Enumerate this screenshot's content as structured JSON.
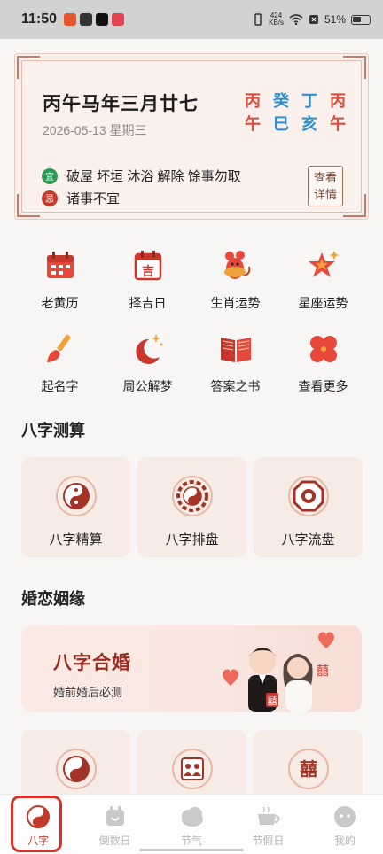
{
  "status_bar": {
    "time": "11:50",
    "net_speed_value": "424",
    "net_speed_unit": "KB/s",
    "battery": "51%"
  },
  "calendar_card": {
    "lunar_date": "丙午马年三月廿七",
    "gregorian_date": "2026-05-13 星期三",
    "ganzhi": [
      {
        "top": "丙",
        "bottom": "午",
        "color": "#e04a3a"
      },
      {
        "top": "癸",
        "bottom": "巳",
        "color": "#2a8fd6"
      },
      {
        "top": "丁",
        "bottom": "亥",
        "color": "#2a8fd6"
      },
      {
        "top": "丙",
        "bottom": "午",
        "color": "#e04a3a"
      }
    ],
    "yi_badge": "宜",
    "yi_text": "破屋 坏垣 沐浴 解除 馀事勿取",
    "ji_badge": "忌",
    "ji_text": "诸事不宜",
    "detail_line1": "查看",
    "detail_line2": "详情"
  },
  "features": [
    {
      "label": "老黄历",
      "icon": "calendar-icon"
    },
    {
      "label": "择吉日",
      "icon": "auspicious-day-icon"
    },
    {
      "label": "生肖运势",
      "icon": "zodiac-rat-icon"
    },
    {
      "label": "星座运势",
      "icon": "star-icon"
    },
    {
      "label": "起名字",
      "icon": "brush-icon"
    },
    {
      "label": "周公解梦",
      "icon": "moon-icon"
    },
    {
      "label": "答案之书",
      "icon": "book-icon"
    },
    {
      "label": "查看更多",
      "icon": "more-icon"
    }
  ],
  "sections": {
    "bazi": "八字测算",
    "marriage": "婚恋姻缘"
  },
  "bazi_cards": [
    {
      "label": "八字精算",
      "icon": "taiji-icon"
    },
    {
      "label": "八字排盘",
      "icon": "bagua-icon"
    },
    {
      "label": "八字流盘",
      "icon": "octagon-icon"
    }
  ],
  "marriage_banner": {
    "title": "八字合婚",
    "subtitle": "婚前婚后必测",
    "badge_text": "囍"
  },
  "marriage_cards": [
    {
      "icon": "taiji-icon"
    },
    {
      "icon": "couple-icon"
    },
    {
      "icon": "double-happiness-icon",
      "glyph": "囍"
    }
  ],
  "tabs": [
    {
      "label": "八字",
      "icon": "taiji-icon",
      "active": true
    },
    {
      "label": "倒数日",
      "icon": "countdown-icon",
      "active": false
    },
    {
      "label": "节气",
      "icon": "cloud-icon",
      "active": false
    },
    {
      "label": "节假日",
      "icon": "cup-icon",
      "active": false
    },
    {
      "label": "我的",
      "icon": "profile-icon",
      "active": false
    }
  ],
  "colors": {
    "accent": "#c0392b",
    "yi_green": "#2d9a55",
    "ji_red": "#c8392b"
  }
}
